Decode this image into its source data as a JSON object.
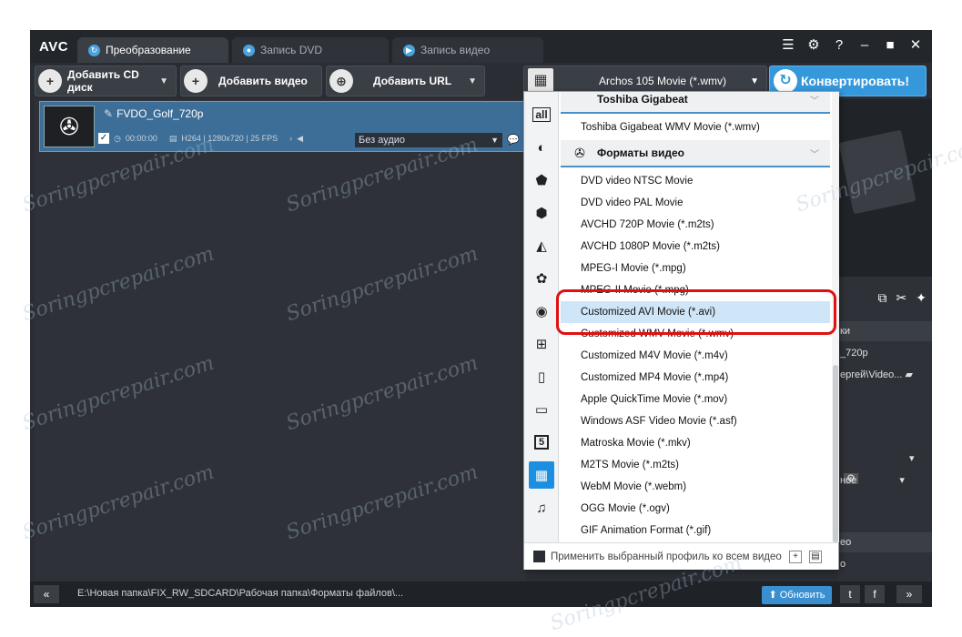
{
  "app": {
    "logo": "AVC",
    "tabs": [
      {
        "label": "Преобразование",
        "active": true
      },
      {
        "label": "Запись DVD",
        "active": false
      },
      {
        "label": "Запись видео",
        "active": false
      }
    ],
    "window_controls": [
      "help",
      "minimize",
      "maximize",
      "close"
    ],
    "help_label": "?"
  },
  "toolbar": {
    "add_cd": "Добавить CD диск",
    "add_video": "Добавить видео",
    "add_url": "Добавить URL",
    "profile_value": "Archos 105 Movie (*.wmv)",
    "convert_label": "Конвертировать!"
  },
  "file": {
    "name": "FVDO_Golf_720p",
    "duration": "00:00:00",
    "codec_info": "H264 | 1280x720 | 25 FPS",
    "audio": "Без аудио"
  },
  "right_panel": {
    "rows": [
      "ки",
      "_720p",
      "ергей\\Video...",
      "",
      "ное",
      "ео",
      "о"
    ]
  },
  "statusbar": {
    "path": "E:\\Новая папка\\FIX_RW_SDCARD\\Рабочая папка\\Форматы файлов\\...",
    "update_label": "Обновить",
    "collapse_label": "«",
    "expand_label": "»"
  },
  "dropdown": {
    "categories": [
      "all",
      "apple",
      "android-s",
      "android",
      "playstation",
      "huawei",
      "lg",
      "windows",
      "mobile",
      "tv",
      "html5",
      "video",
      "music"
    ],
    "selected_category": "video",
    "all_label": "all",
    "html5_label": "5",
    "group_toshiba": "Toshiba Gigabeat",
    "toshiba_items": [
      "Toshiba Gigabeat WMV Movie (*.wmv)"
    ],
    "group_video": "Форматы видео",
    "video_items": [
      "DVD video NTSC Movie",
      "DVD video PAL Movie",
      "AVCHD 720P Movie (*.m2ts)",
      "AVCHD 1080P Movie (*.m2ts)",
      "MPEG-I Movie (*.mpg)",
      "MPEG-II Movie (*.mpg)",
      "Customized AVI Movie (*.avi)",
      "Customized WMV Movie (*.wmv)",
      "Customized M4V Movie (*.m4v)",
      "Customized MP4 Movie (*.mp4)",
      "Apple QuickTime Movie (*.mov)",
      "Windows ASF Video Movie (*.asf)",
      "Matroska Movie (*.mkv)",
      "M2TS Movie (*.m2ts)",
      "WebM Movie (*.webm)",
      "OGG Movie (*.ogv)",
      "GIF Animation Format (*.gif)"
    ],
    "highlighted_item": "Customized AVI Movie (*.avi)",
    "footer_text": "Применить выбранный профиль ко всем видео"
  },
  "watermark": "Soringpcrepair.com",
  "colors": {
    "accent": "#3498db",
    "highlight_box": "#e01010",
    "selected_row": "#cfe6f8"
  }
}
